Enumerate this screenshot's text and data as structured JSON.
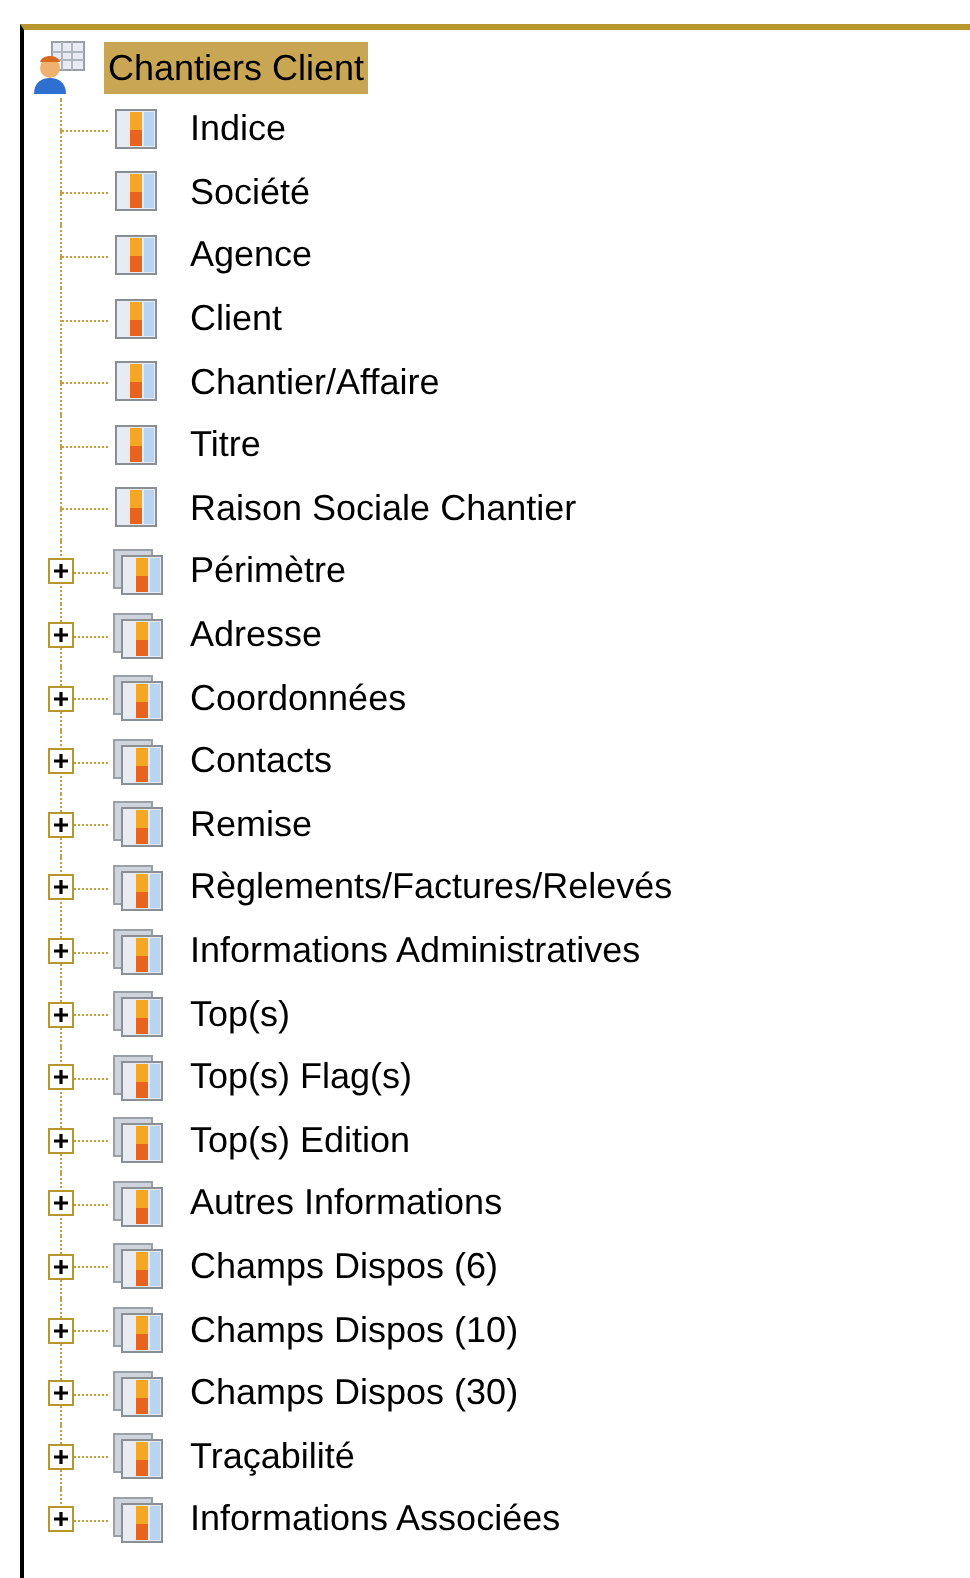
{
  "tree": {
    "label": "Chantiers Client",
    "selected": true,
    "children": [
      {
        "kind": "field",
        "label": "Indice"
      },
      {
        "kind": "field",
        "label": "Société"
      },
      {
        "kind": "field",
        "label": "Agence"
      },
      {
        "kind": "field",
        "label": "Client"
      },
      {
        "kind": "field",
        "label": "Chantier/Affaire"
      },
      {
        "kind": "field",
        "label": "Titre"
      },
      {
        "kind": "field",
        "label": "Raison Sociale Chantier"
      },
      {
        "kind": "group",
        "label": "Périmètre",
        "expanded": false
      },
      {
        "kind": "group",
        "label": "Adresse",
        "expanded": false
      },
      {
        "kind": "group",
        "label": "Coordonnées",
        "expanded": false
      },
      {
        "kind": "group",
        "label": "Contacts",
        "expanded": false
      },
      {
        "kind": "group",
        "label": "Remise",
        "expanded": false
      },
      {
        "kind": "group",
        "label": "Règlements/Factures/Relevés",
        "expanded": false
      },
      {
        "kind": "group",
        "label": "Informations Administratives",
        "expanded": false
      },
      {
        "kind": "group",
        "label": "Top(s)",
        "expanded": false
      },
      {
        "kind": "group",
        "label": "Top(s) Flag(s)",
        "expanded": false
      },
      {
        "kind": "group",
        "label": "Top(s) Edition",
        "expanded": false
      },
      {
        "kind": "group",
        "label": "Autres Informations",
        "expanded": false
      },
      {
        "kind": "group",
        "label": "Champs Dispos (6)",
        "expanded": false
      },
      {
        "kind": "group",
        "label": "Champs Dispos (10)",
        "expanded": false
      },
      {
        "kind": "group",
        "label": "Champs Dispos (30)",
        "expanded": false
      },
      {
        "kind": "group",
        "label": "Traçabilité",
        "expanded": false
      },
      {
        "kind": "group",
        "label": "Informations Associées",
        "expanded": false
      }
    ]
  }
}
